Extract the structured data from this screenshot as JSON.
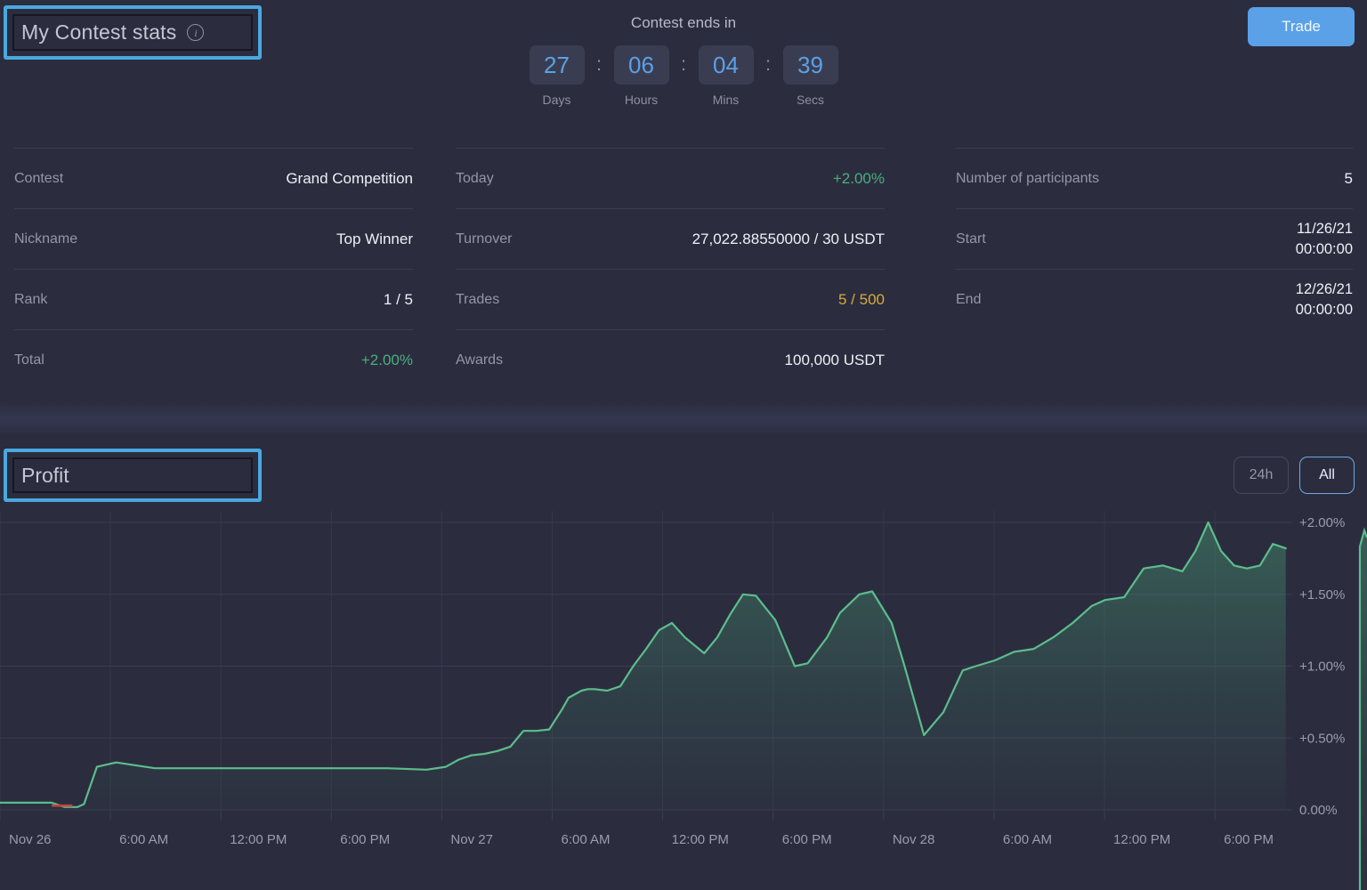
{
  "header": {
    "title": "My Contest stats",
    "info_icon": "info-icon",
    "trade_label": "Trade"
  },
  "countdown": {
    "label": "Contest ends in",
    "separator": ":",
    "units": [
      {
        "value": "27",
        "name": "Days"
      },
      {
        "value": "06",
        "name": "Hours"
      },
      {
        "value": "04",
        "name": "Mins"
      },
      {
        "value": "39",
        "name": "Secs"
      }
    ]
  },
  "stats": {
    "col1": [
      {
        "label": "Contest",
        "value": "Grand Competition"
      },
      {
        "label": "Nickname",
        "value": "Top Winner"
      },
      {
        "label": "Rank",
        "value": "1 / 5"
      },
      {
        "label": "Total",
        "value": "+2.00%"
      }
    ],
    "col2": [
      {
        "label": "Today",
        "value": "+2.00%"
      },
      {
        "label": "Turnover",
        "value": "27,022.88550000 / 30 USDT"
      },
      {
        "label": "Trades",
        "value": "5 / 500"
      },
      {
        "label": "Awards",
        "value": "100,000 USDT"
      }
    ],
    "col3": [
      {
        "label": "Number of participants",
        "value": "5"
      },
      {
        "label": "Start",
        "value_line1": "11/26/21",
        "value_line2": "00:00:00"
      },
      {
        "label": "End",
        "value_line1": "12/26/21",
        "value_line2": "00:00:00"
      }
    ]
  },
  "profit": {
    "title": "Profit",
    "range_24h": "24h",
    "range_all": "All"
  },
  "colors": {
    "accent_blue": "#5aa1e8",
    "highlight_blue": "#4aa8e0",
    "positive_green": "#4cae7e",
    "warning_yellow": "#d9a93a",
    "negative_red": "#c4453f",
    "background": "#2b2d3e"
  },
  "chart_data": {
    "type": "area",
    "title": "Profit",
    "xlabel": "",
    "ylabel": "",
    "ylim": [
      0.0,
      2.2
    ],
    "grid": true,
    "legend": "none",
    "ytick_labels": [
      "+2.00%",
      "+1.50%",
      "+1.00%",
      "+0.50%",
      "0.00%"
    ],
    "ytick_values": [
      2.0,
      1.5,
      1.0,
      0.5,
      0.0
    ],
    "xtick_labels": [
      "Nov 26",
      "6:00 AM",
      "12:00 PM",
      "6:00 PM",
      "Nov 27",
      "6:00 AM",
      "12:00 PM",
      "6:00 PM",
      "Nov 28",
      "6:00 AM",
      "12:00 PM",
      "6:00 PM"
    ],
    "series": [
      {
        "name": "Profit %",
        "x": [
          0.0,
          0.04,
          0.05,
          0.06,
          0.065,
          0.075,
          0.09,
          0.12,
          0.16,
          0.2,
          0.26,
          0.3,
          0.33,
          0.345,
          0.355,
          0.365,
          0.375,
          0.385,
          0.395,
          0.405,
          0.415,
          0.425,
          0.435,
          0.44,
          0.45,
          0.455,
          0.46,
          0.47,
          0.48,
          0.49,
          0.5,
          0.51,
          0.52,
          0.53,
          0.545,
          0.555,
          0.565,
          0.575,
          0.585,
          0.6,
          0.615,
          0.625,
          0.64,
          0.65,
          0.665,
          0.675,
          0.69,
          0.7,
          0.715,
          0.73,
          0.745,
          0.755,
          0.77,
          0.785,
          0.8,
          0.815,
          0.83,
          0.845,
          0.855,
          0.87,
          0.885,
          0.9,
          0.915,
          0.925,
          0.935,
          0.945,
          0.955,
          0.965,
          0.975,
          0.985,
          0.995
        ],
        "y": [
          0.05,
          0.05,
          0.02,
          0.02,
          0.04,
          0.3,
          0.33,
          0.29,
          0.29,
          0.29,
          0.29,
          0.29,
          0.28,
          0.3,
          0.35,
          0.38,
          0.39,
          0.41,
          0.44,
          0.55,
          0.55,
          0.56,
          0.7,
          0.78,
          0.83,
          0.84,
          0.84,
          0.83,
          0.86,
          1.0,
          1.12,
          1.25,
          1.3,
          1.2,
          1.09,
          1.2,
          1.36,
          1.5,
          1.49,
          1.32,
          1.0,
          1.02,
          1.2,
          1.37,
          1.5,
          1.52,
          1.3,
          1.0,
          0.52,
          0.68,
          0.97,
          1.0,
          1.04,
          1.1,
          1.12,
          1.2,
          1.3,
          1.42,
          1.46,
          1.48,
          1.68,
          1.7,
          1.66,
          1.8,
          2.0,
          1.8,
          1.7,
          1.68,
          1.7,
          1.85,
          1.82
        ]
      }
    ],
    "negative_segment": {
      "x_start": 0.04,
      "x_end": 0.056,
      "y": 0.03
    }
  }
}
